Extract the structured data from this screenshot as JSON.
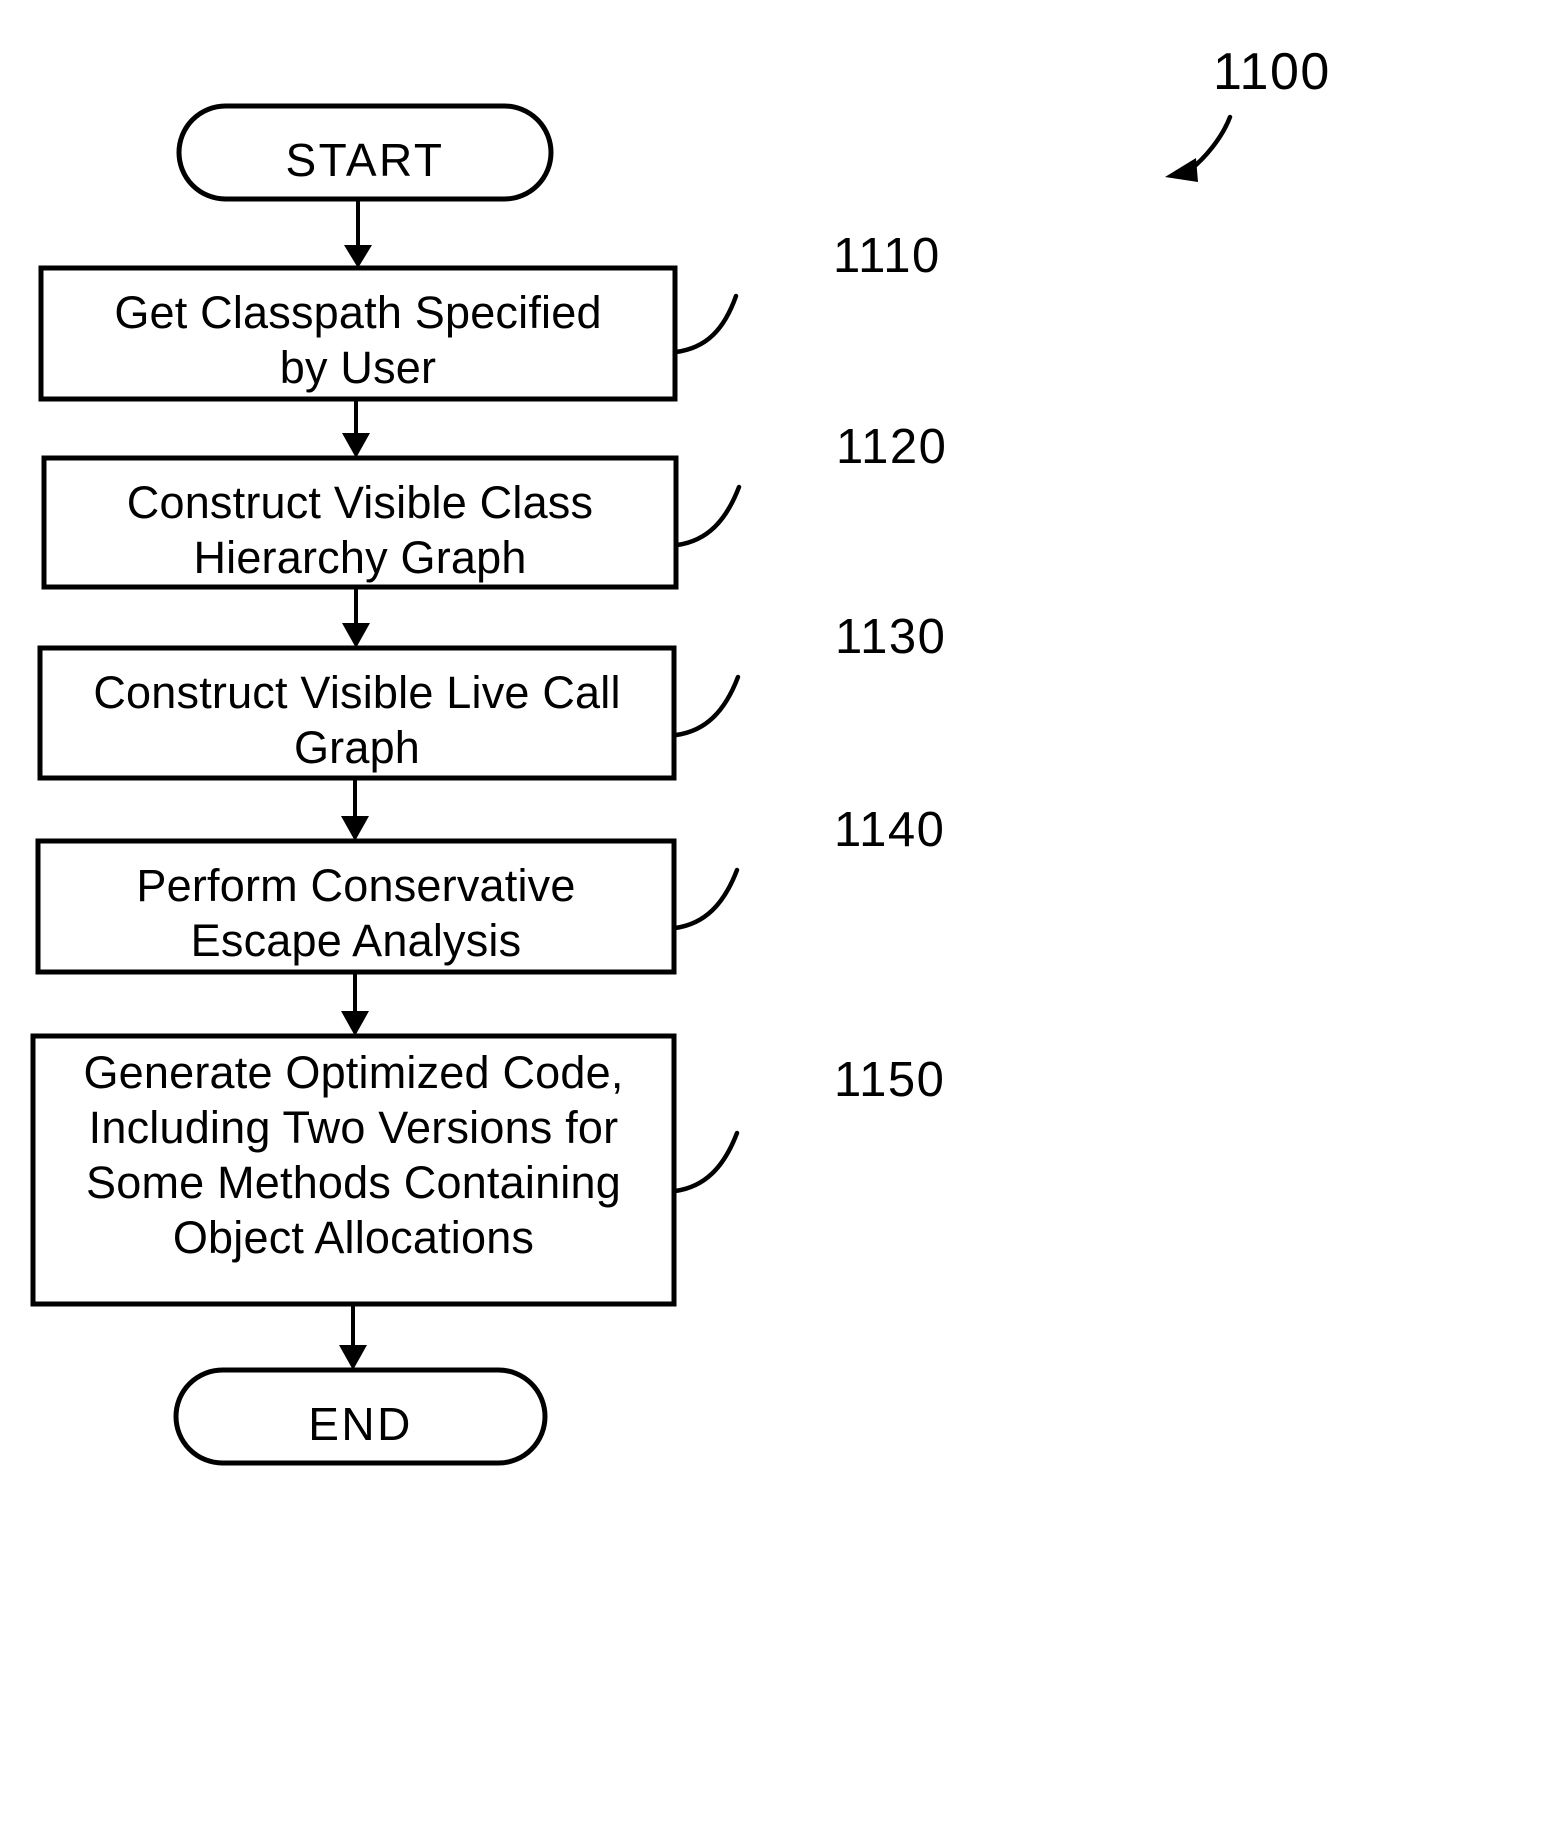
{
  "figure": {
    "number": "1100",
    "callout_icon": "curved-arrow-icon"
  },
  "flowchart": {
    "type": "flowchart",
    "orientation": "top-to-bottom",
    "nodes": [
      {
        "id": "start",
        "shape": "terminal",
        "label": "START",
        "ref": null
      },
      {
        "id": "step-1110",
        "shape": "process",
        "label": "Get Classpath Specified\nby User",
        "ref": "1110"
      },
      {
        "id": "step-1120",
        "shape": "process",
        "label": "Construct Visible Class\nHierarchy Graph",
        "ref": "1120"
      },
      {
        "id": "step-1130",
        "shape": "process",
        "label": "Construct Visible Live Call\nGraph",
        "ref": "1130"
      },
      {
        "id": "step-1140",
        "shape": "process",
        "label": "Perform Conservative\nEscape Analysis",
        "ref": "1140"
      },
      {
        "id": "step-1150",
        "shape": "process",
        "label": "Generate Optimized Code,\nIncluding Two Versions for\nSome Methods Containing\nObject Allocations",
        "ref": "1150"
      },
      {
        "id": "end",
        "shape": "terminal",
        "label": "END",
        "ref": null
      }
    ],
    "edges": [
      {
        "from": "start",
        "to": "step-1110",
        "arrow": "down-arrow-icon"
      },
      {
        "from": "step-1110",
        "to": "step-1120",
        "arrow": "down-arrow-icon"
      },
      {
        "from": "step-1120",
        "to": "step-1130",
        "arrow": "down-arrow-icon"
      },
      {
        "from": "step-1130",
        "to": "step-1140",
        "arrow": "down-arrow-icon"
      },
      {
        "from": "step-1140",
        "to": "step-1150",
        "arrow": "down-arrow-icon"
      },
      {
        "from": "step-1150",
        "to": "end",
        "arrow": "down-arrow-icon"
      }
    ],
    "colors": {
      "stroke": "#000000",
      "fill": "#ffffff",
      "background": "#ffffff"
    }
  }
}
